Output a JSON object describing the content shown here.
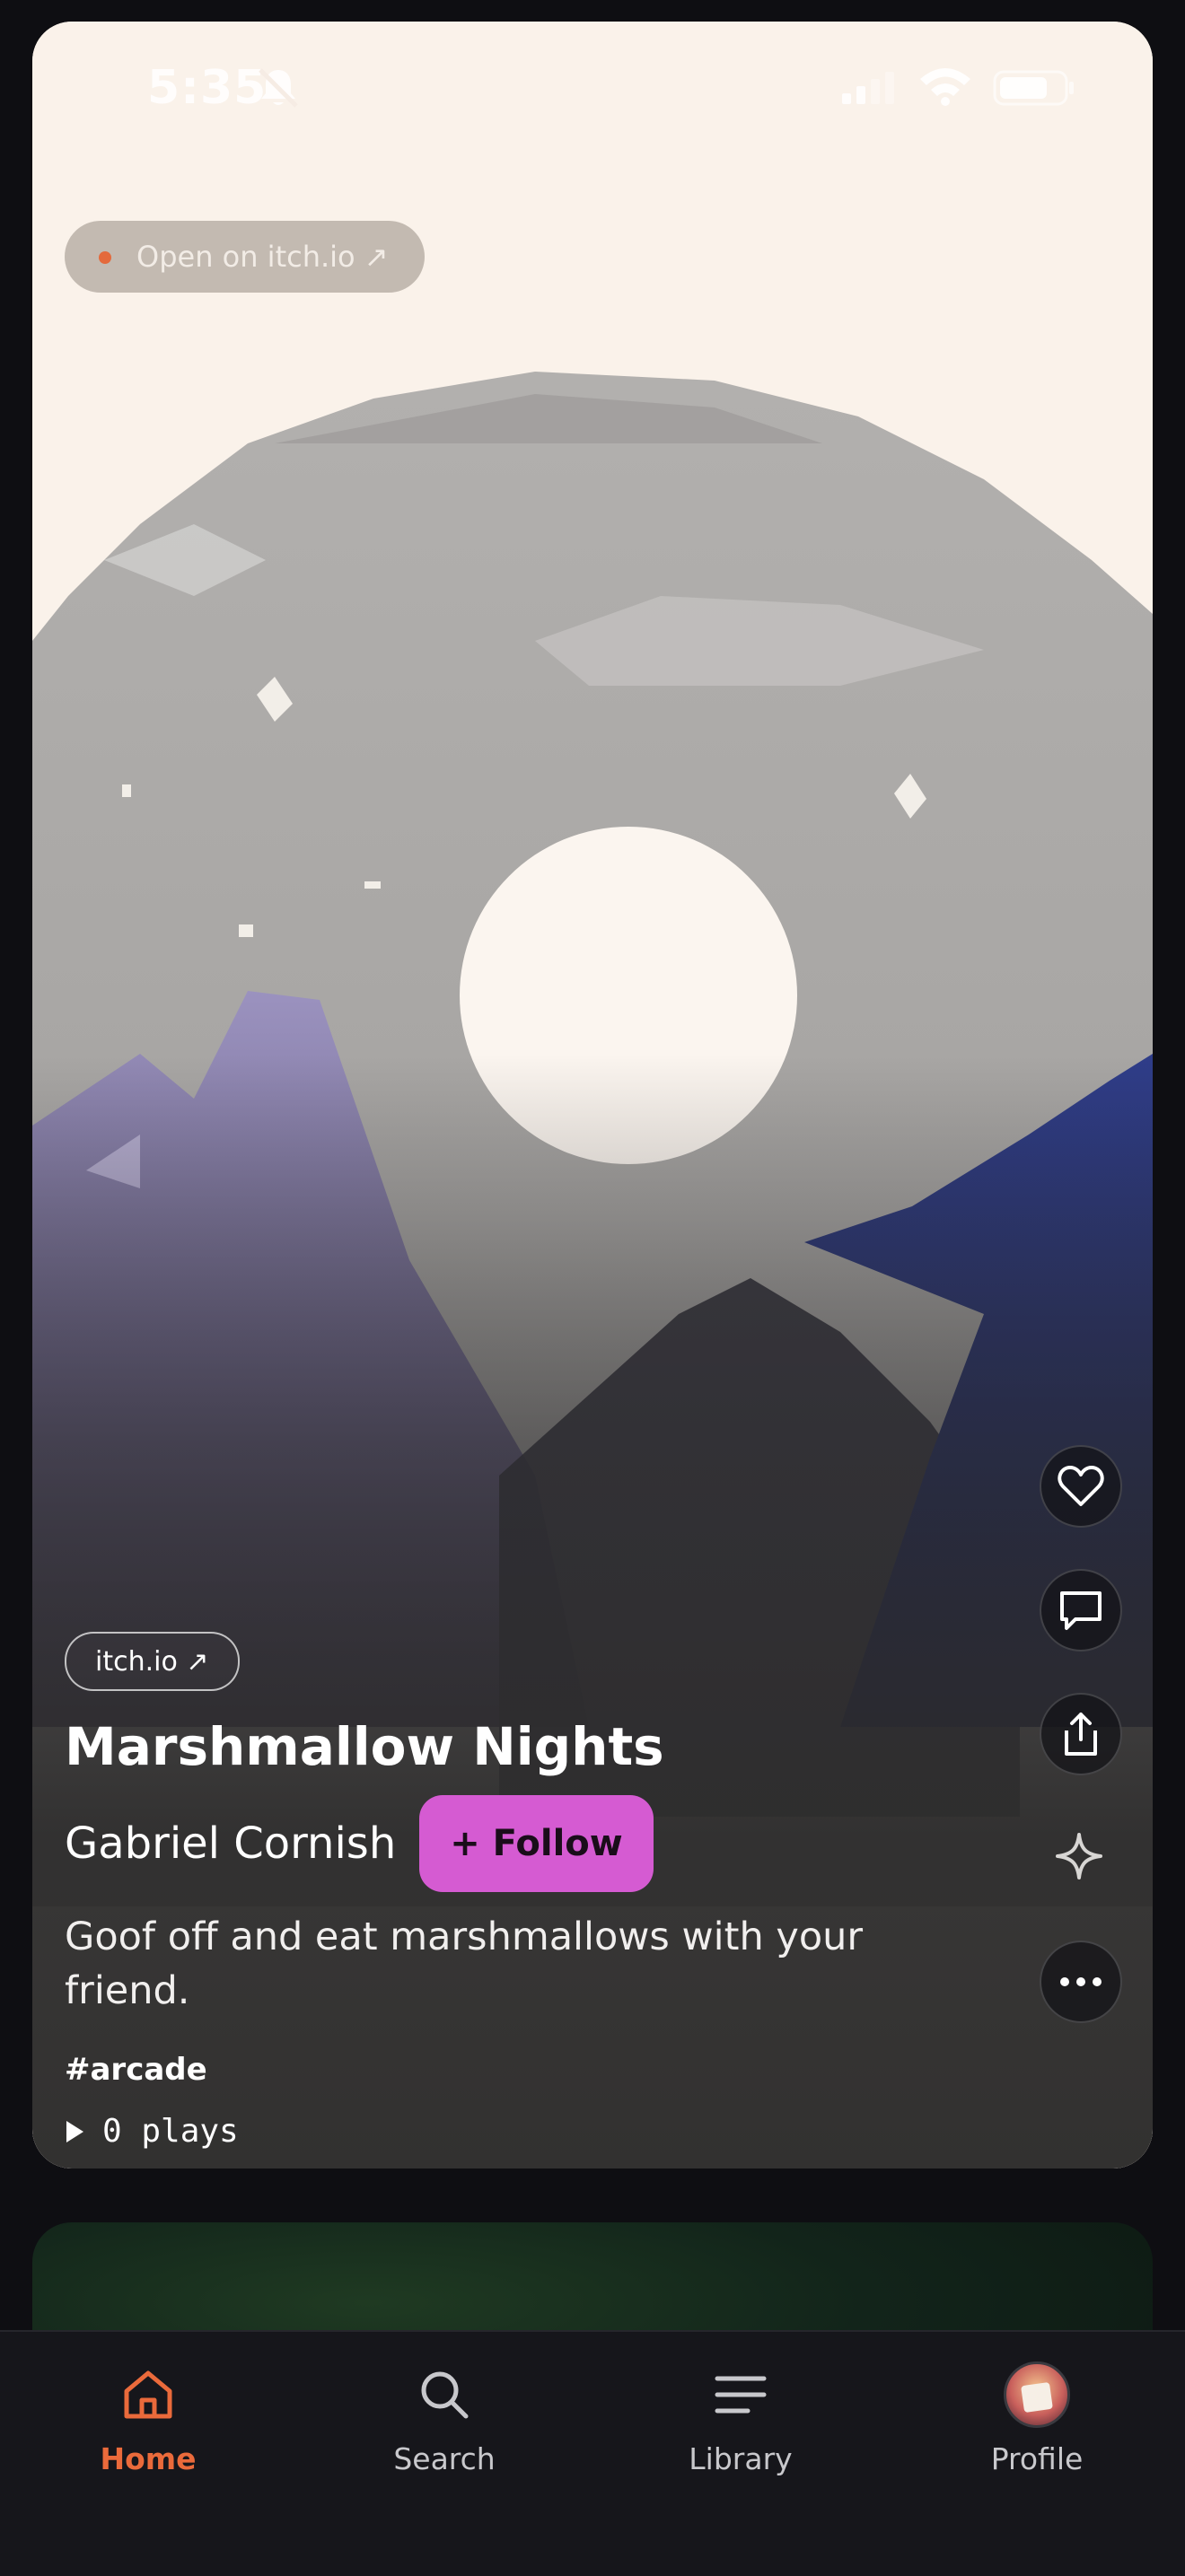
{
  "status_bar": {
    "time": "5:35"
  },
  "card": {
    "open_link": "Open on itch.io ↗",
    "source_badge": "itch.io ↗",
    "title": "Marshmallow Nights",
    "author": "Gabriel Cornish",
    "follow_label": "+ Follow",
    "description": "Goof off and eat marshmallows with your friend.",
    "tag": "#arcade",
    "plays": "0 plays"
  },
  "actions": [
    "heart-icon",
    "comment-icon",
    "share-icon",
    "sparkle-icon",
    "more-icon"
  ],
  "tabs": [
    {
      "label": "Home",
      "icon": "home-icon",
      "active": true
    },
    {
      "label": "Search",
      "icon": "search-icon",
      "active": false
    },
    {
      "label": "Library",
      "icon": "library-icon",
      "active": false
    },
    {
      "label": "Profile",
      "icon": "avatar",
      "active": false
    }
  ],
  "colors": {
    "accent": "#ea6a3b",
    "follow": "#d55bd2",
    "background": "#0e0e12"
  }
}
